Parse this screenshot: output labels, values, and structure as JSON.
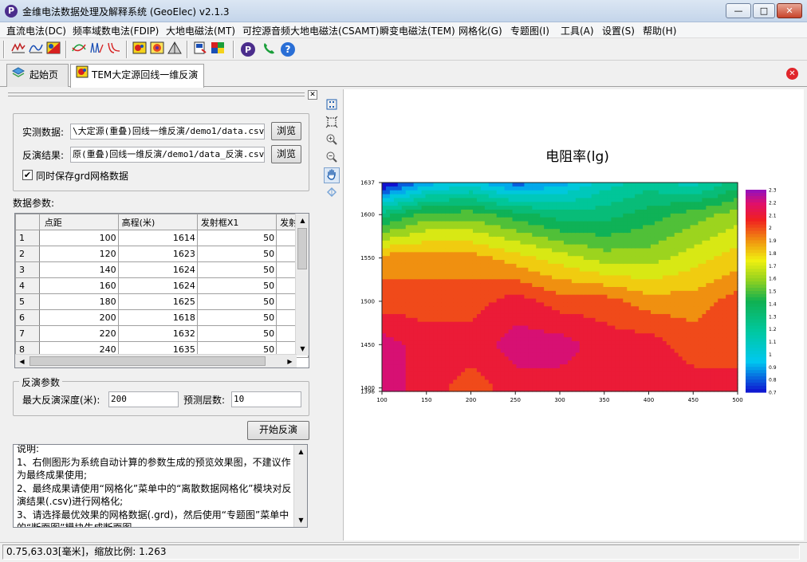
{
  "window": {
    "title": "金维电法数据处理及解释系统 (GeoElec)  v2.1.3",
    "app_icon_letter": "P",
    "minimize": "—",
    "maximize": "□",
    "close": "✕"
  },
  "menu": [
    "直流电法(DC)",
    "频率域数电法(FDIP)",
    "大地电磁法(MT)",
    "可控源音频大地电磁法(CSAMT)",
    "瞬变电磁法(TEM)",
    "网格化(G)",
    "专题图(I)",
    "工具(A)",
    "设置(S)",
    "帮助(H)"
  ],
  "tabs": [
    {
      "label": "起始页",
      "icon": "layers-icon"
    },
    {
      "label": "TEM大定源回线一维反演",
      "icon": "tem-icon"
    }
  ],
  "input_group": {
    "data_label": "实测数据:",
    "data_value": "\\大定源(重叠)回线一维反演/demo1/data.csv",
    "result_label": "反演结果:",
    "result_value": "原(重叠)回线一维反演/demo1/data_反演.csv",
    "browse_label": "浏览",
    "save_grd_label": "同时保存grd网格数据",
    "save_grd_checked": "✔"
  },
  "params_label": "数据参数:",
  "table": {
    "headers": [
      "",
      "点距",
      "高程(米)",
      "发射框X1",
      "发射"
    ],
    "rows": [
      [
        "1",
        "100",
        "1614",
        "50"
      ],
      [
        "2",
        "120",
        "1623",
        "50"
      ],
      [
        "3",
        "140",
        "1624",
        "50"
      ],
      [
        "4",
        "160",
        "1624",
        "50"
      ],
      [
        "5",
        "180",
        "1625",
        "50"
      ],
      [
        "6",
        "200",
        "1618",
        "50"
      ],
      [
        "7",
        "220",
        "1632",
        "50"
      ],
      [
        "8",
        "240",
        "1635",
        "50"
      ]
    ]
  },
  "inversion": {
    "group_title": "反演参数",
    "depth_label": "最大反演深度(米):",
    "depth_value": "200",
    "layers_label": "预测层数:",
    "layers_value": "10",
    "start_label": "开始反演"
  },
  "notes": "说明:\n1、右侧图形为系统自动计算的参数生成的预览效果图，不建议作为最终成果使用;\n2、最终成果请使用“网格化”菜单中的“离散数据网格化”模块对反演结果(.csv)进行网格化;\n3、请选择最优效果的网格数据(.grd)，然后使用“专题图”菜单中的“断面图”模块生成断面图。",
  "status": "0.75,63.03[毫米]，缩放比例: 1.263",
  "colors": {
    "titlebar": "#c4d5ea",
    "accent": "#1f5fb0",
    "close_red": "#e0262b"
  },
  "chart_data": {
    "type": "heatmap",
    "title": "电阻率(lg)",
    "xlabel": "",
    "ylabel": "",
    "x_ticks": [
      "100",
      "150",
      "200",
      "250",
      "300",
      "350",
      "400",
      "450",
      "500"
    ],
    "y_ticks": [
      "1637",
      "1600",
      "1550",
      "1500",
      "1450",
      "1400",
      "1396"
    ],
    "colorbar_ticks": [
      "2.3",
      "2.2",
      "2.1",
      "2",
      "1.9",
      "1.8",
      "1.7",
      "1.6",
      "1.5",
      "1.4",
      "1.3",
      "1.2",
      "1.1",
      "1",
      "0.9",
      "0.8",
      "0.7"
    ],
    "xlim": [
      100,
      500
    ],
    "ylim": [
      1396,
      1637
    ],
    "zlim": [
      0.7,
      2.3
    ],
    "x": [
      100,
      150,
      200,
      250,
      300,
      350,
      400,
      450,
      500
    ],
    "y": [
      1637,
      1600,
      1550,
      1500,
      1450,
      1400
    ],
    "z": [
      [
        0.6,
        0.9,
        1.0,
        0.8,
        0.9,
        1.1,
        1.2,
        1.1,
        1.3
      ],
      [
        1.3,
        1.5,
        1.5,
        1.4,
        1.3,
        1.3,
        1.4,
        1.5,
        1.6
      ],
      [
        1.9,
        1.9,
        1.9,
        1.8,
        1.7,
        1.6,
        1.6,
        1.7,
        1.8
      ],
      [
        2.0,
        2.0,
        2.0,
        2.1,
        2.0,
        2.0,
        1.9,
        1.9,
        2.0
      ],
      [
        2.2,
        2.1,
        2.1,
        2.2,
        2.2,
        2.1,
        2.1,
        2.0,
        2.0
      ],
      [
        2.2,
        2.1,
        2.0,
        2.1,
        2.1,
        2.1,
        2.1,
        2.1,
        2.1
      ]
    ]
  }
}
